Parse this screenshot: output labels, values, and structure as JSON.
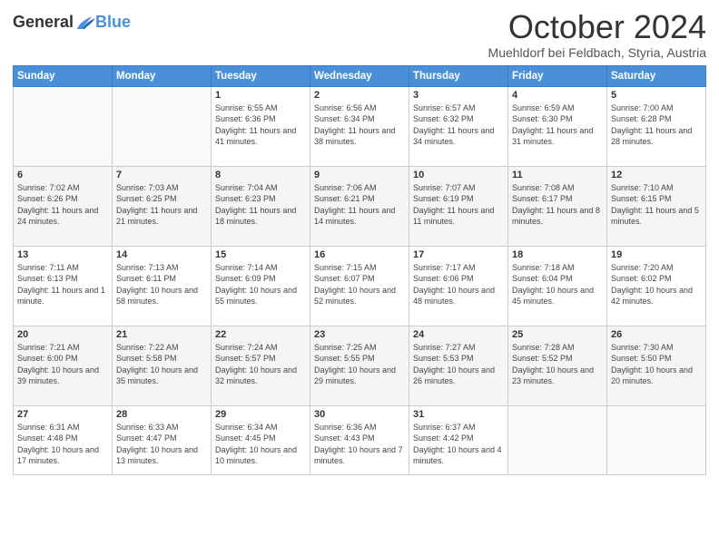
{
  "header": {
    "logo": {
      "general": "General",
      "blue": "Blue"
    },
    "title": "October 2024",
    "subtitle": "Muehldorf bei Feldbach, Styria, Austria"
  },
  "weekdays": [
    "Sunday",
    "Monday",
    "Tuesday",
    "Wednesday",
    "Thursday",
    "Friday",
    "Saturday"
  ],
  "weeks": [
    [
      {
        "day": "",
        "info": ""
      },
      {
        "day": "",
        "info": ""
      },
      {
        "day": "1",
        "sunrise": "6:55 AM",
        "sunset": "6:36 PM",
        "daylight": "11 hours and 41 minutes."
      },
      {
        "day": "2",
        "sunrise": "6:56 AM",
        "sunset": "6:34 PM",
        "daylight": "11 hours and 38 minutes."
      },
      {
        "day": "3",
        "sunrise": "6:57 AM",
        "sunset": "6:32 PM",
        "daylight": "11 hours and 34 minutes."
      },
      {
        "day": "4",
        "sunrise": "6:59 AM",
        "sunset": "6:30 PM",
        "daylight": "11 hours and 31 minutes."
      },
      {
        "day": "5",
        "sunrise": "7:00 AM",
        "sunset": "6:28 PM",
        "daylight": "11 hours and 28 minutes."
      }
    ],
    [
      {
        "day": "6",
        "sunrise": "7:02 AM",
        "sunset": "6:26 PM",
        "daylight": "11 hours and 24 minutes."
      },
      {
        "day": "7",
        "sunrise": "7:03 AM",
        "sunset": "6:25 PM",
        "daylight": "11 hours and 21 minutes."
      },
      {
        "day": "8",
        "sunrise": "7:04 AM",
        "sunset": "6:23 PM",
        "daylight": "11 hours and 18 minutes."
      },
      {
        "day": "9",
        "sunrise": "7:06 AM",
        "sunset": "6:21 PM",
        "daylight": "11 hours and 14 minutes."
      },
      {
        "day": "10",
        "sunrise": "7:07 AM",
        "sunset": "6:19 PM",
        "daylight": "11 hours and 11 minutes."
      },
      {
        "day": "11",
        "sunrise": "7:08 AM",
        "sunset": "6:17 PM",
        "daylight": "11 hours and 8 minutes."
      },
      {
        "day": "12",
        "sunrise": "7:10 AM",
        "sunset": "6:15 PM",
        "daylight": "11 hours and 5 minutes."
      }
    ],
    [
      {
        "day": "13",
        "sunrise": "7:11 AM",
        "sunset": "6:13 PM",
        "daylight": "11 hours and 1 minute."
      },
      {
        "day": "14",
        "sunrise": "7:13 AM",
        "sunset": "6:11 PM",
        "daylight": "10 hours and 58 minutes."
      },
      {
        "day": "15",
        "sunrise": "7:14 AM",
        "sunset": "6:09 PM",
        "daylight": "10 hours and 55 minutes."
      },
      {
        "day": "16",
        "sunrise": "7:15 AM",
        "sunset": "6:07 PM",
        "daylight": "10 hours and 52 minutes."
      },
      {
        "day": "17",
        "sunrise": "7:17 AM",
        "sunset": "6:06 PM",
        "daylight": "10 hours and 48 minutes."
      },
      {
        "day": "18",
        "sunrise": "7:18 AM",
        "sunset": "6:04 PM",
        "daylight": "10 hours and 45 minutes."
      },
      {
        "day": "19",
        "sunrise": "7:20 AM",
        "sunset": "6:02 PM",
        "daylight": "10 hours and 42 minutes."
      }
    ],
    [
      {
        "day": "20",
        "sunrise": "7:21 AM",
        "sunset": "6:00 PM",
        "daylight": "10 hours and 39 minutes."
      },
      {
        "day": "21",
        "sunrise": "7:22 AM",
        "sunset": "5:58 PM",
        "daylight": "10 hours and 35 minutes."
      },
      {
        "day": "22",
        "sunrise": "7:24 AM",
        "sunset": "5:57 PM",
        "daylight": "10 hours and 32 minutes."
      },
      {
        "day": "23",
        "sunrise": "7:25 AM",
        "sunset": "5:55 PM",
        "daylight": "10 hours and 29 minutes."
      },
      {
        "day": "24",
        "sunrise": "7:27 AM",
        "sunset": "5:53 PM",
        "daylight": "10 hours and 26 minutes."
      },
      {
        "day": "25",
        "sunrise": "7:28 AM",
        "sunset": "5:52 PM",
        "daylight": "10 hours and 23 minutes."
      },
      {
        "day": "26",
        "sunrise": "7:30 AM",
        "sunset": "5:50 PM",
        "daylight": "10 hours and 20 minutes."
      }
    ],
    [
      {
        "day": "27",
        "sunrise": "6:31 AM",
        "sunset": "4:48 PM",
        "daylight": "10 hours and 17 minutes."
      },
      {
        "day": "28",
        "sunrise": "6:33 AM",
        "sunset": "4:47 PM",
        "daylight": "10 hours and 13 minutes."
      },
      {
        "day": "29",
        "sunrise": "6:34 AM",
        "sunset": "4:45 PM",
        "daylight": "10 hours and 10 minutes."
      },
      {
        "day": "30",
        "sunrise": "6:36 AM",
        "sunset": "4:43 PM",
        "daylight": "10 hours and 7 minutes."
      },
      {
        "day": "31",
        "sunrise": "6:37 AM",
        "sunset": "4:42 PM",
        "daylight": "10 hours and 4 minutes."
      },
      {
        "day": "",
        "info": ""
      },
      {
        "day": "",
        "info": ""
      }
    ]
  ],
  "colors": {
    "header_bg": "#4a90d9",
    "header_text": "#ffffff",
    "accent": "#4a90d9"
  }
}
